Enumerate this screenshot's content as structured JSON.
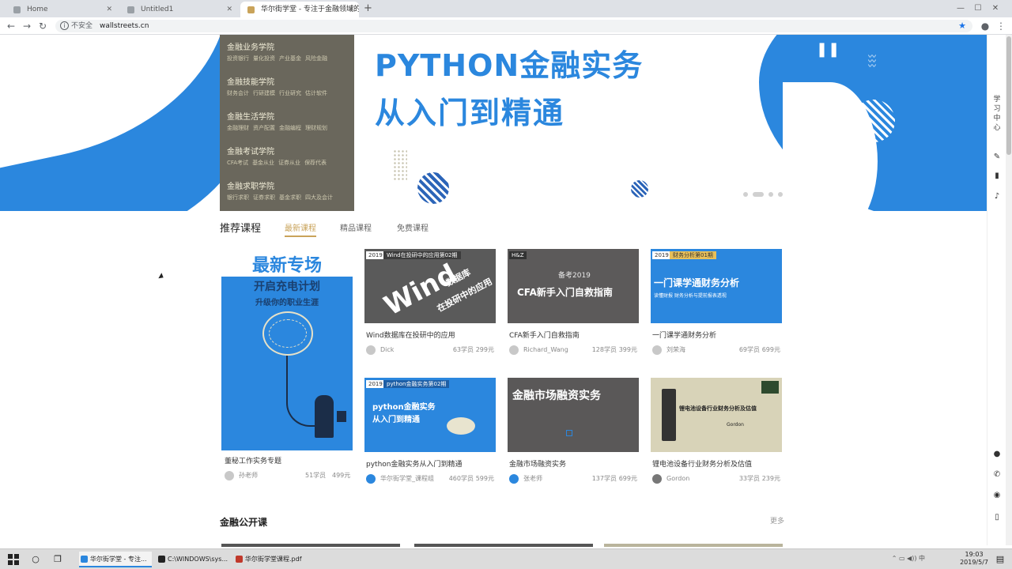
{
  "browser": {
    "tabs": [
      {
        "label": "Home"
      },
      {
        "label": "Untitled1"
      },
      {
        "label": "华尔街学堂 - 专注于金融领域的在"
      }
    ],
    "insecure_label": "不安全",
    "url": "wallstreets.cn"
  },
  "hero": {
    "title": "PYTHON金融实务",
    "subtitle": "从入门到精通",
    "categories": [
      {
        "name": "金融业务学院",
        "subs": [
          "投资银行",
          "量化投资",
          "产业基金",
          "风险金融"
        ]
      },
      {
        "name": "金融技能学院",
        "subs": [
          "财务会计",
          "行研建模",
          "行业研究",
          "估计软件"
        ]
      },
      {
        "name": "金融生活学院",
        "subs": [
          "金融理财",
          "资产配置",
          "金融编程",
          "理财规划"
        ]
      },
      {
        "name": "金融考试学院",
        "subs": [
          "CFA考试",
          "基金从业",
          "证券从业",
          "保荐代表"
        ]
      },
      {
        "name": "金融求职学院",
        "subs": [
          "银行求职",
          "证券求职",
          "基金求职",
          "四大及会计"
        ]
      }
    ]
  },
  "sidebar": {
    "vertical_text": "学习中心"
  },
  "recommend": {
    "title": "推荐课程",
    "tabs": [
      "最新课程",
      "精品课程",
      "免费课程"
    ],
    "feature": {
      "headline": "最新专场",
      "line1": "开启充电计划",
      "line2": "升级你的职业生涯",
      "course_title": "董秘工作实务专题",
      "author": "孙老师",
      "students": "51学员",
      "price": "499元"
    },
    "cards": [
      {
        "badge": "2019",
        "tag": "Wind在投研中的应用第02期",
        "big": "Wind",
        "big2": "数据库",
        "big3": "在投研中的应用",
        "title": "Wind数据库在投研中的应用",
        "author": "Dick",
        "students": "63学员",
        "price": "299元"
      },
      {
        "badge": "H&Z",
        "tag": "",
        "big": "CFA新手入门自救指南",
        "big2": "备考2019",
        "big3": "",
        "title": "CFA新手入门自救指南",
        "author": "Richard_Wang",
        "students": "128学员",
        "price": "399元"
      },
      {
        "badge": "2019",
        "tag": "财务分析第01期",
        "big": "一门课学通财务分析",
        "big2": "读懂财报  财务分析与提前报表透视",
        "big3": "",
        "title": "一门课学通财务分析",
        "author": "刘荣海",
        "students": "69学员",
        "price": "699元"
      },
      {
        "badge": "2019",
        "tag": "python金融实务第02期",
        "big": "python金融实务",
        "big2": "从入门到精通",
        "big3": "",
        "title": "python金融实务从入门到精通",
        "author": "华尔街学堂_课程组",
        "students": "460学员",
        "price": "599元"
      },
      {
        "badge": "",
        "tag": "",
        "big": "金融市场融资实务",
        "big2": "",
        "big3": "",
        "title": "金融市场融资实务",
        "author": "张老师",
        "students": "137学员",
        "price": "699元"
      },
      {
        "badge": "",
        "tag": "",
        "big": "锂电池设备行业财务分析及估值",
        "big2": "Gordon",
        "big3": "",
        "title": "锂电池设备行业财务分析及估值",
        "author": "Gordon",
        "students": "33学员",
        "price": "239元"
      }
    ]
  },
  "public": {
    "title": "金融公开课",
    "more": "更多"
  },
  "taskbar": {
    "items": [
      "华尔街学堂 - 专注...",
      "C:\\WINDOWS\\sys...",
      "华尔街学堂课程.pdf"
    ],
    "time": "19:03",
    "date": "2019/5/7"
  },
  "colors": {
    "brand_blue": "#2b87de",
    "menu_bg": "#6a675c",
    "accent_gold": "#c9a35a"
  }
}
